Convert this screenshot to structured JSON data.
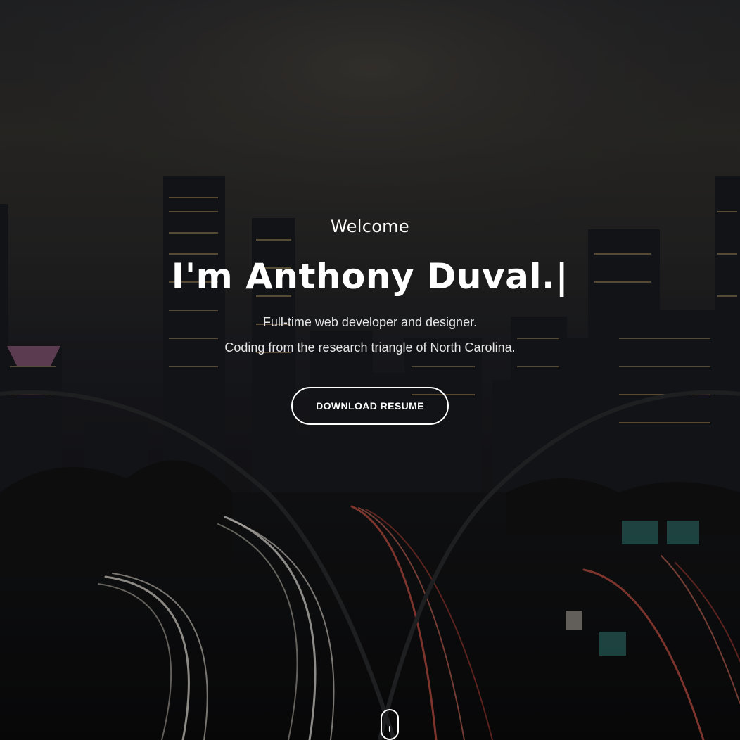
{
  "hero": {
    "welcome": "Welcome",
    "headline": "I'm Anthony Duval.|",
    "tagline_line1": "Full-time web developer and designer.",
    "tagline_line2": "Coding from the research triangle of North Carolina.",
    "cta_label": "DOWNLOAD RESUME",
    "scroll_indicator_icon": "mouse-scroll-icon",
    "background_image": "night-city-skyline-with-highway-light-trails",
    "text_color": "#ffffff"
  }
}
